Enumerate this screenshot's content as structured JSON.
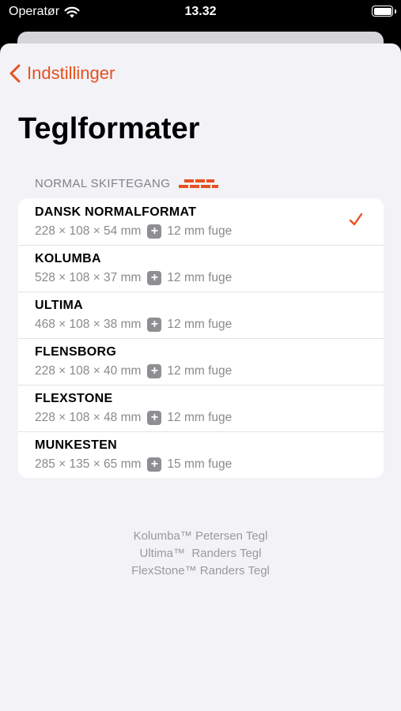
{
  "status_bar": {
    "carrier": "Operatør",
    "time": "13.32"
  },
  "nav": {
    "back_label": "Indstillinger"
  },
  "page": {
    "title": "Teglformater"
  },
  "section": {
    "header": "NORMAL SKIFTEGANG",
    "icon": "brick-icon"
  },
  "formats": [
    {
      "name": "DANSK NORMALFORMAT",
      "dims": "228 × 108 × 54 mm",
      "joint": "12 mm fuge",
      "selected": true
    },
    {
      "name": "KOLUMBA",
      "dims": "528 × 108 × 37 mm",
      "joint": "12 mm fuge",
      "selected": false
    },
    {
      "name": "ULTIMA",
      "dims": "468 × 108 × 38 mm",
      "joint": "12 mm fuge",
      "selected": false
    },
    {
      "name": "FLENSBORG",
      "dims": "228 × 108 × 40 mm",
      "joint": "12 mm fuge",
      "selected": false
    },
    {
      "name": "FLEXSTONE",
      "dims": "228 × 108 × 48 mm",
      "joint": "12 mm fuge",
      "selected": false
    },
    {
      "name": "MUNKESTEN",
      "dims": "285 × 135 × 65 mm",
      "joint": "15 mm fuge",
      "selected": false
    }
  ],
  "footer": {
    "line1": "Kolumba™ Petersen Tegl",
    "line2": "Ultima™  Randers Tegl",
    "line3": "FlexStone™ Randers Tegl"
  },
  "colors": {
    "accent": "#e8501f",
    "background": "#f2f2f7"
  }
}
